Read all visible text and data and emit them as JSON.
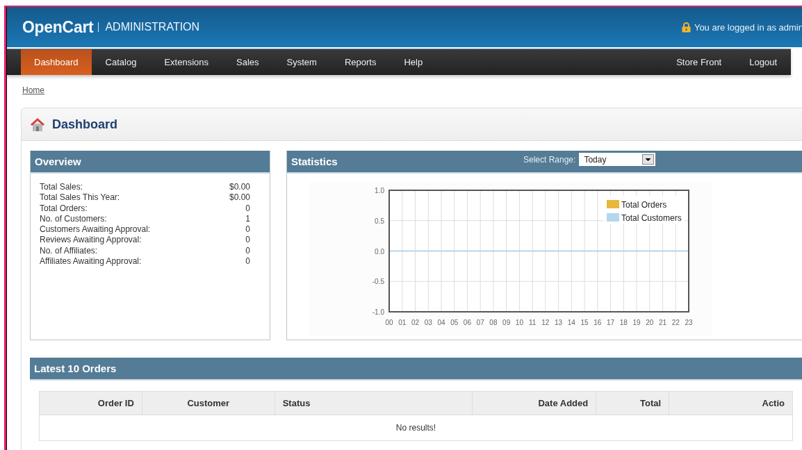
{
  "header": {
    "logo": "OpenCart",
    "subtitle": "ADMINISTRATION",
    "login_text": "You are logged in as admin"
  },
  "nav": {
    "items": [
      {
        "label": "Dashboard",
        "selected": true
      },
      {
        "label": "Catalog",
        "selected": false
      },
      {
        "label": "Extensions",
        "selected": false
      },
      {
        "label": "Sales",
        "selected": false
      },
      {
        "label": "System",
        "selected": false
      },
      {
        "label": "Reports",
        "selected": false
      },
      {
        "label": "Help",
        "selected": false
      }
    ],
    "right_items": [
      "Store Front",
      "Logout"
    ]
  },
  "breadcrumb": [
    "Home"
  ],
  "page_title": "Dashboard",
  "overview": {
    "title": "Overview",
    "rows": [
      {
        "label": "Total Sales:",
        "value": "$0.00"
      },
      {
        "label": "Total Sales This Year:",
        "value": "$0.00"
      },
      {
        "label": "Total Orders:",
        "value": "0"
      },
      {
        "label": "No. of Customers:",
        "value": "1"
      },
      {
        "label": "Customers Awaiting Approval:",
        "value": "0"
      },
      {
        "label": "Reviews Awaiting Approval:",
        "value": "0"
      },
      {
        "label": "No. of Affiliates:",
        "value": "0"
      },
      {
        "label": "Affiliates Awaiting Approval:",
        "value": "0"
      }
    ]
  },
  "statistics": {
    "title": "Statistics",
    "range_label": "Select Range:",
    "range_value": "Today",
    "chart_data": {
      "type": "line",
      "categories": [
        "00",
        "01",
        "02",
        "03",
        "04",
        "05",
        "06",
        "07",
        "08",
        "09",
        "10",
        "11",
        "12",
        "13",
        "14",
        "15",
        "16",
        "17",
        "18",
        "19",
        "20",
        "21",
        "22",
        "23"
      ],
      "series": [
        {
          "name": "Total Orders",
          "color": "#e8b83a",
          "values": [
            null,
            null,
            null,
            null,
            null,
            null,
            null,
            null,
            null,
            null,
            null,
            null,
            null,
            null,
            null,
            null,
            null,
            null,
            null,
            null,
            null,
            null,
            null,
            null
          ]
        },
        {
          "name": "Total Customers",
          "color": "#b5d6ec",
          "values": [
            0,
            0,
            0,
            0,
            0,
            0,
            0,
            0,
            0,
            0,
            0,
            0,
            0,
            0,
            0,
            0,
            0,
            0,
            0,
            0,
            0,
            0,
            0,
            0
          ]
        }
      ],
      "ylim": [
        -1,
        1
      ],
      "grid": true,
      "legend": true,
      "yticks": [
        {
          "value": -1,
          "label": "-1.0"
        },
        {
          "value": -0.5,
          "label": "-0.5"
        },
        {
          "value": 0,
          "label": "0.0"
        },
        {
          "value": 0.5,
          "label": "0.5"
        },
        {
          "value": 1,
          "label": "1.0"
        }
      ]
    }
  },
  "latest_orders": {
    "title": "Latest 10 Orders",
    "columns": [
      "Order ID",
      "Customer",
      "Status",
      "Date Added",
      "Total",
      "Actio"
    ],
    "empty_message": "No results!"
  }
}
